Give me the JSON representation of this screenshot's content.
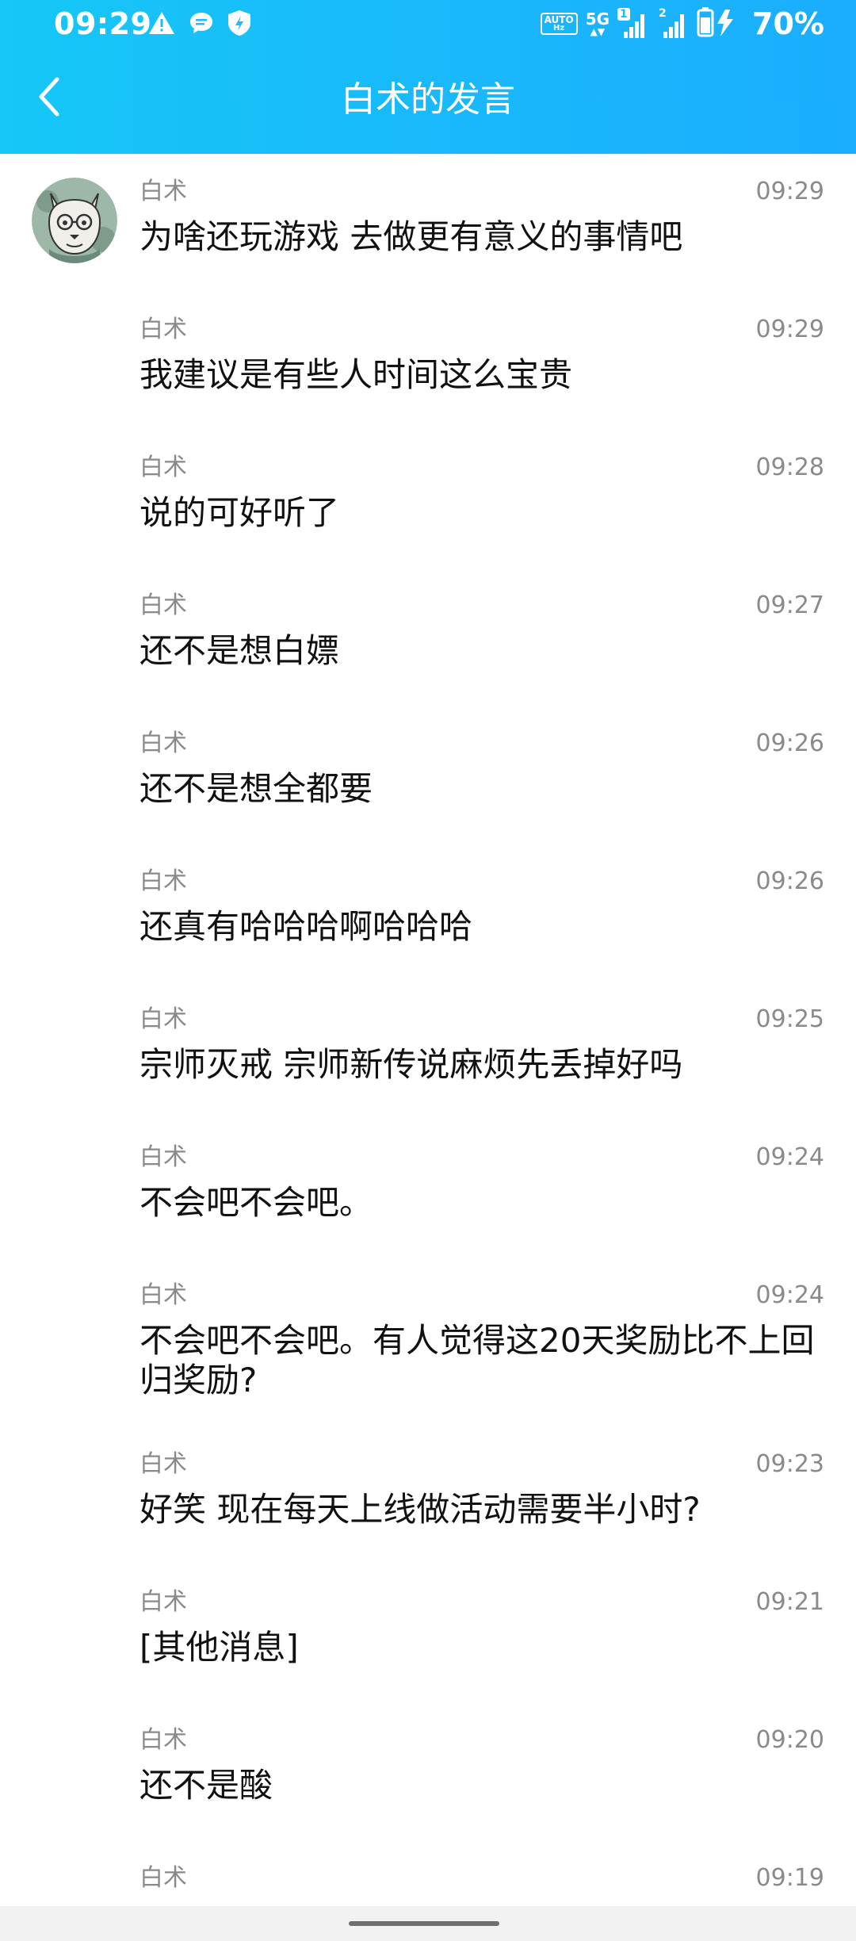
{
  "status_bar": {
    "time": "09:29",
    "network_label": "5G",
    "sim1_badge": "1",
    "sim2_badge": "2",
    "battery_percent": "70%",
    "auto_label_top": "AUTO",
    "auto_label_bottom": "Hz",
    "icons": [
      "warning-icon",
      "message-icon",
      "app-shield-icon",
      "auto-hz-icon",
      "signal-icon",
      "signal-icon",
      "battery-charging-icon"
    ]
  },
  "header": {
    "title": "白术的发言",
    "back_icon": "back-arrow-icon"
  },
  "colors": {
    "header_gradient_start": "#16c7f7",
    "header_gradient_end": "#1aaefd",
    "meta_text": "#8a8a8a",
    "message_text": "#111111"
  },
  "messages": [
    {
      "sender": "白术",
      "time": "09:29",
      "text": "为啥还玩游戏 去做更有意义的事情吧"
    },
    {
      "sender": "白术",
      "time": "09:29",
      "text": "我建议是有些人时间这么宝贵"
    },
    {
      "sender": "白术",
      "time": "09:28",
      "text": "说的可好听了"
    },
    {
      "sender": "白术",
      "time": "09:27",
      "text": "还不是想白嫖"
    },
    {
      "sender": "白术",
      "time": "09:26",
      "text": "还不是想全都要"
    },
    {
      "sender": "白术",
      "time": "09:26",
      "text": "还真有哈哈哈啊哈哈哈"
    },
    {
      "sender": "白术",
      "time": "09:25",
      "text": "宗师灭戒 宗师新传说麻烦先丢掉好吗"
    },
    {
      "sender": "白术",
      "time": "09:24",
      "text": "不会吧不会吧。"
    },
    {
      "sender": "白术",
      "time": "09:24",
      "text": "不会吧不会吧。有人觉得这20天奖励比不上回归奖励?"
    },
    {
      "sender": "白术",
      "time": "09:23",
      "text": "好笑 现在每天上线做活动需要半小时?"
    },
    {
      "sender": "白术",
      "time": "09:21",
      "text": "[其他消息]"
    },
    {
      "sender": "白术",
      "time": "09:20",
      "text": "还不是酸"
    },
    {
      "sender": "白术",
      "time": "09:19",
      "text": ""
    }
  ]
}
